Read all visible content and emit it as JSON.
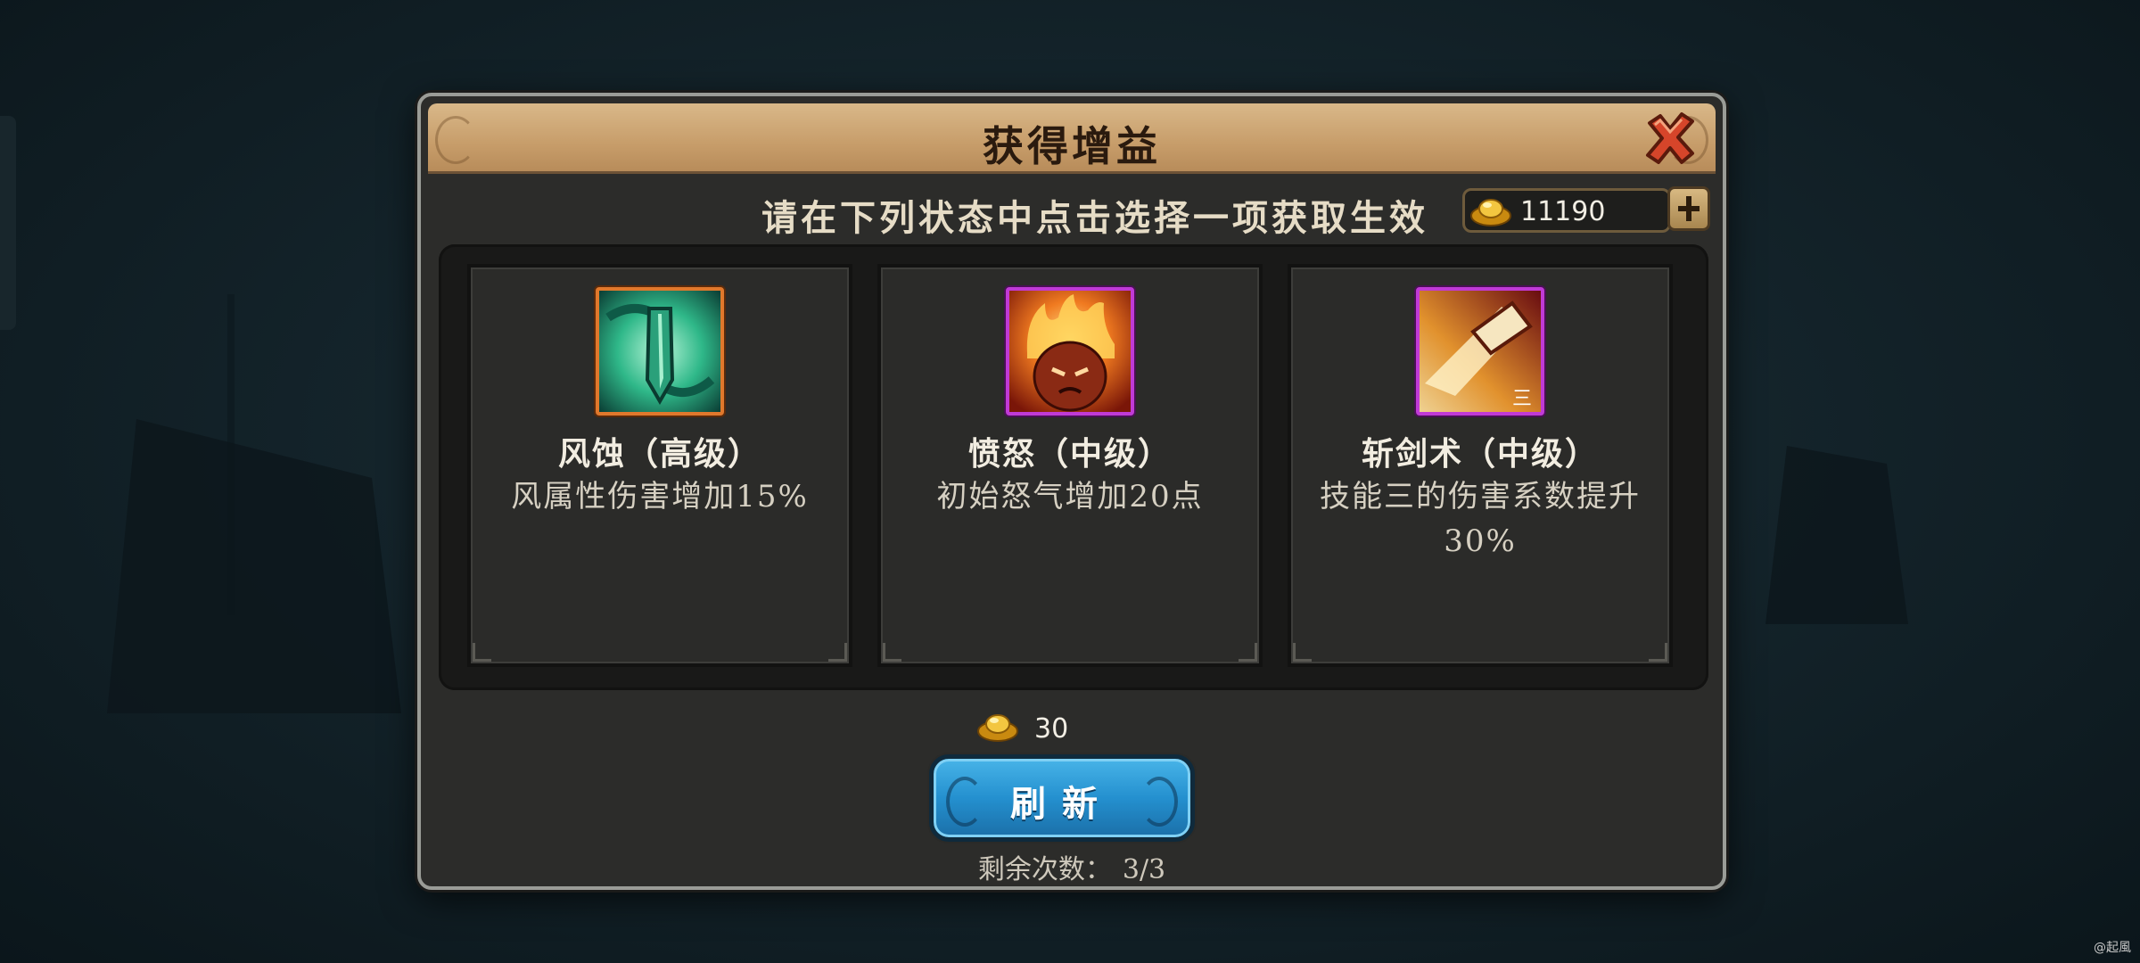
{
  "dialog": {
    "title": "获得增益",
    "instruction": "请在下列状态中点击选择一项获取生效",
    "currency": {
      "icon": "gold-ingot-icon",
      "amount": "11190"
    }
  },
  "cards": [
    {
      "icon": "wind-blade-skill-icon",
      "frame_color": "#e0782c",
      "name": "风蚀（高级）",
      "description": "风属性伤害增加15%"
    },
    {
      "icon": "rage-fire-skill-icon",
      "frame_color": "#c03ad6",
      "name": "愤怒（中级）",
      "description": "初始怒气增加20点"
    },
    {
      "icon": "sword-slash-skill-icon",
      "frame_color": "#c03ad6",
      "name": "斩剑术（中级）",
      "description": "技能三的伤害系数提升30%"
    }
  ],
  "refresh": {
    "cost_icon": "gold-ingot-icon",
    "cost": "30",
    "label": "刷新",
    "remaining_label": "剩余次数：",
    "remaining_value": "3/3"
  },
  "watermark": "@起風"
}
